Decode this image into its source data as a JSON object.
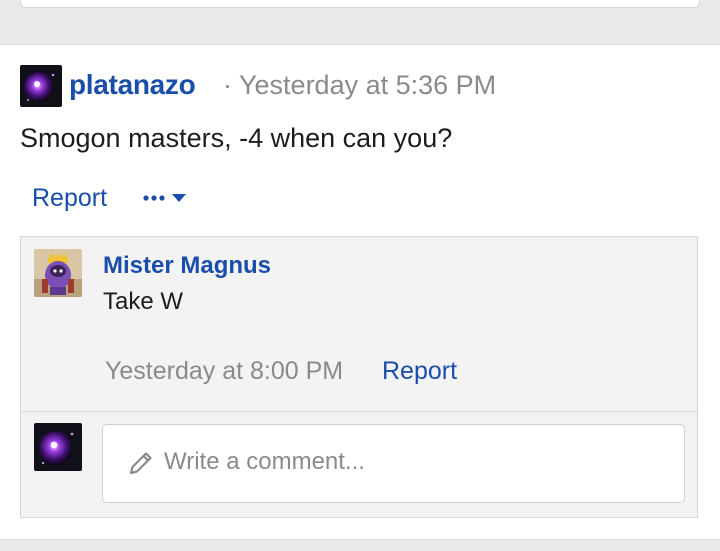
{
  "post": {
    "author": "platanazo",
    "meta": "· Yesterday at 5:36 PM",
    "body": "Smogon masters, -4 when can you?",
    "report_label": "Report",
    "more_label": "•••",
    "icons": {
      "avatar": "avatar-purple-orb-icon",
      "more": "more-dots-icon",
      "caret": "caret-down-icon"
    }
  },
  "comments": [
    {
      "author": "Mister Magnus",
      "text": "Take W",
      "time": "Yesterday at 8:00 PM",
      "report_label": "Report",
      "avatar_icon": "avatar-king-character-icon"
    }
  ],
  "reply": {
    "placeholder": "Write a comment...",
    "pencil_icon": "pencil-icon",
    "avatar_icon": "avatar-purple-orb-icon"
  },
  "colors": {
    "link": "#1a4ea8",
    "meta": "#8a8a8e",
    "text": "#1d1d1d",
    "background": "#e9e9ea",
    "comment_bg": "#f3f3f4"
  }
}
